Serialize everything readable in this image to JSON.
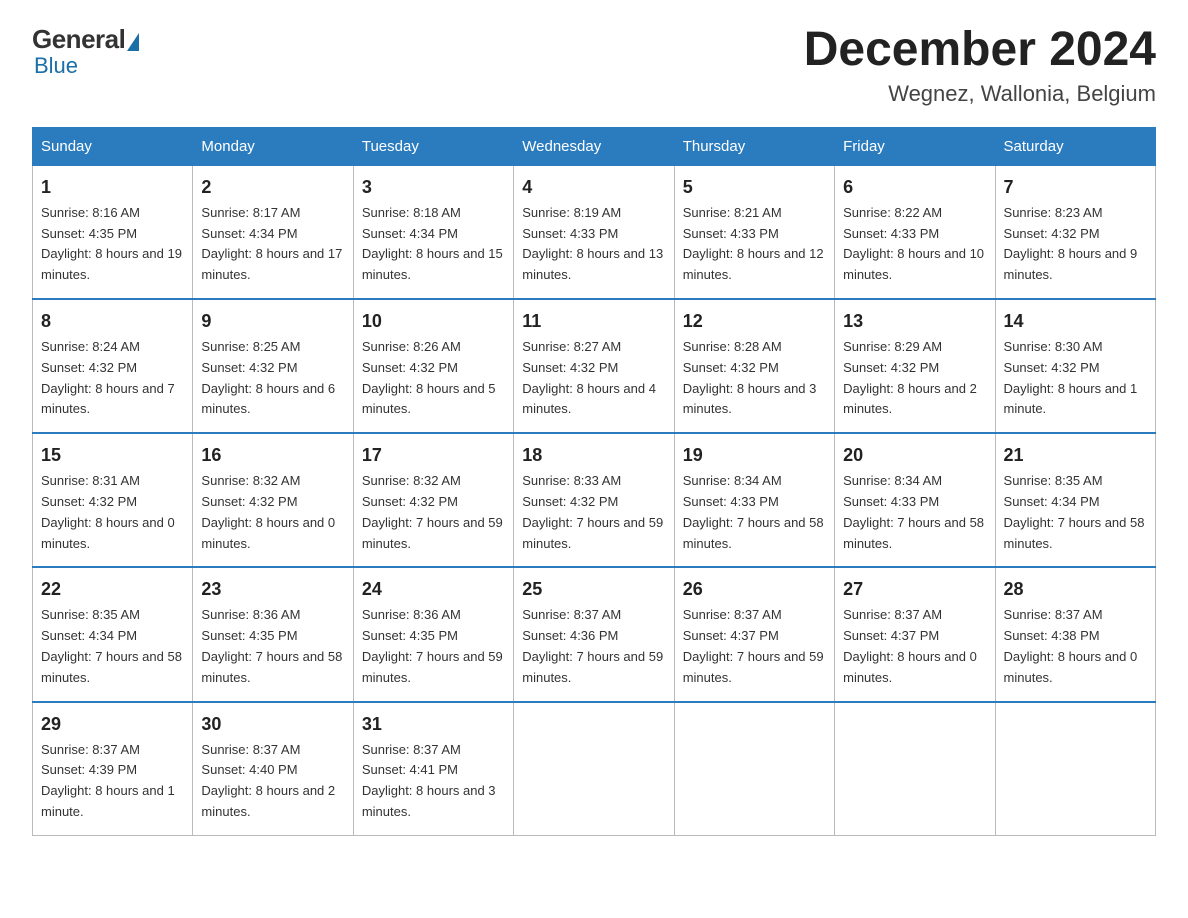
{
  "logo": {
    "general": "General",
    "blue": "Blue"
  },
  "title": "December 2024",
  "location": "Wegnez, Wallonia, Belgium",
  "days_header": [
    "Sunday",
    "Monday",
    "Tuesday",
    "Wednesday",
    "Thursday",
    "Friday",
    "Saturday"
  ],
  "weeks": [
    [
      {
        "day": "1",
        "sunrise": "8:16 AM",
        "sunset": "4:35 PM",
        "daylight": "8 hours and 19 minutes."
      },
      {
        "day": "2",
        "sunrise": "8:17 AM",
        "sunset": "4:34 PM",
        "daylight": "8 hours and 17 minutes."
      },
      {
        "day": "3",
        "sunrise": "8:18 AM",
        "sunset": "4:34 PM",
        "daylight": "8 hours and 15 minutes."
      },
      {
        "day": "4",
        "sunrise": "8:19 AM",
        "sunset": "4:33 PM",
        "daylight": "8 hours and 13 minutes."
      },
      {
        "day": "5",
        "sunrise": "8:21 AM",
        "sunset": "4:33 PM",
        "daylight": "8 hours and 12 minutes."
      },
      {
        "day": "6",
        "sunrise": "8:22 AM",
        "sunset": "4:33 PM",
        "daylight": "8 hours and 10 minutes."
      },
      {
        "day": "7",
        "sunrise": "8:23 AM",
        "sunset": "4:32 PM",
        "daylight": "8 hours and 9 minutes."
      }
    ],
    [
      {
        "day": "8",
        "sunrise": "8:24 AM",
        "sunset": "4:32 PM",
        "daylight": "8 hours and 7 minutes."
      },
      {
        "day": "9",
        "sunrise": "8:25 AM",
        "sunset": "4:32 PM",
        "daylight": "8 hours and 6 minutes."
      },
      {
        "day": "10",
        "sunrise": "8:26 AM",
        "sunset": "4:32 PM",
        "daylight": "8 hours and 5 minutes."
      },
      {
        "day": "11",
        "sunrise": "8:27 AM",
        "sunset": "4:32 PM",
        "daylight": "8 hours and 4 minutes."
      },
      {
        "day": "12",
        "sunrise": "8:28 AM",
        "sunset": "4:32 PM",
        "daylight": "8 hours and 3 minutes."
      },
      {
        "day": "13",
        "sunrise": "8:29 AM",
        "sunset": "4:32 PM",
        "daylight": "8 hours and 2 minutes."
      },
      {
        "day": "14",
        "sunrise": "8:30 AM",
        "sunset": "4:32 PM",
        "daylight": "8 hours and 1 minute."
      }
    ],
    [
      {
        "day": "15",
        "sunrise": "8:31 AM",
        "sunset": "4:32 PM",
        "daylight": "8 hours and 0 minutes."
      },
      {
        "day": "16",
        "sunrise": "8:32 AM",
        "sunset": "4:32 PM",
        "daylight": "8 hours and 0 minutes."
      },
      {
        "day": "17",
        "sunrise": "8:32 AM",
        "sunset": "4:32 PM",
        "daylight": "7 hours and 59 minutes."
      },
      {
        "day": "18",
        "sunrise": "8:33 AM",
        "sunset": "4:32 PM",
        "daylight": "7 hours and 59 minutes."
      },
      {
        "day": "19",
        "sunrise": "8:34 AM",
        "sunset": "4:33 PM",
        "daylight": "7 hours and 58 minutes."
      },
      {
        "day": "20",
        "sunrise": "8:34 AM",
        "sunset": "4:33 PM",
        "daylight": "7 hours and 58 minutes."
      },
      {
        "day": "21",
        "sunrise": "8:35 AM",
        "sunset": "4:34 PM",
        "daylight": "7 hours and 58 minutes."
      }
    ],
    [
      {
        "day": "22",
        "sunrise": "8:35 AM",
        "sunset": "4:34 PM",
        "daylight": "7 hours and 58 minutes."
      },
      {
        "day": "23",
        "sunrise": "8:36 AM",
        "sunset": "4:35 PM",
        "daylight": "7 hours and 58 minutes."
      },
      {
        "day": "24",
        "sunrise": "8:36 AM",
        "sunset": "4:35 PM",
        "daylight": "7 hours and 59 minutes."
      },
      {
        "day": "25",
        "sunrise": "8:37 AM",
        "sunset": "4:36 PM",
        "daylight": "7 hours and 59 minutes."
      },
      {
        "day": "26",
        "sunrise": "8:37 AM",
        "sunset": "4:37 PM",
        "daylight": "7 hours and 59 minutes."
      },
      {
        "day": "27",
        "sunrise": "8:37 AM",
        "sunset": "4:37 PM",
        "daylight": "8 hours and 0 minutes."
      },
      {
        "day": "28",
        "sunrise": "8:37 AM",
        "sunset": "4:38 PM",
        "daylight": "8 hours and 0 minutes."
      }
    ],
    [
      {
        "day": "29",
        "sunrise": "8:37 AM",
        "sunset": "4:39 PM",
        "daylight": "8 hours and 1 minute."
      },
      {
        "day": "30",
        "sunrise": "8:37 AM",
        "sunset": "4:40 PM",
        "daylight": "8 hours and 2 minutes."
      },
      {
        "day": "31",
        "sunrise": "8:37 AM",
        "sunset": "4:41 PM",
        "daylight": "8 hours and 3 minutes."
      },
      null,
      null,
      null,
      null
    ]
  ],
  "labels": {
    "sunrise": "Sunrise:",
    "sunset": "Sunset:",
    "daylight": "Daylight:"
  }
}
